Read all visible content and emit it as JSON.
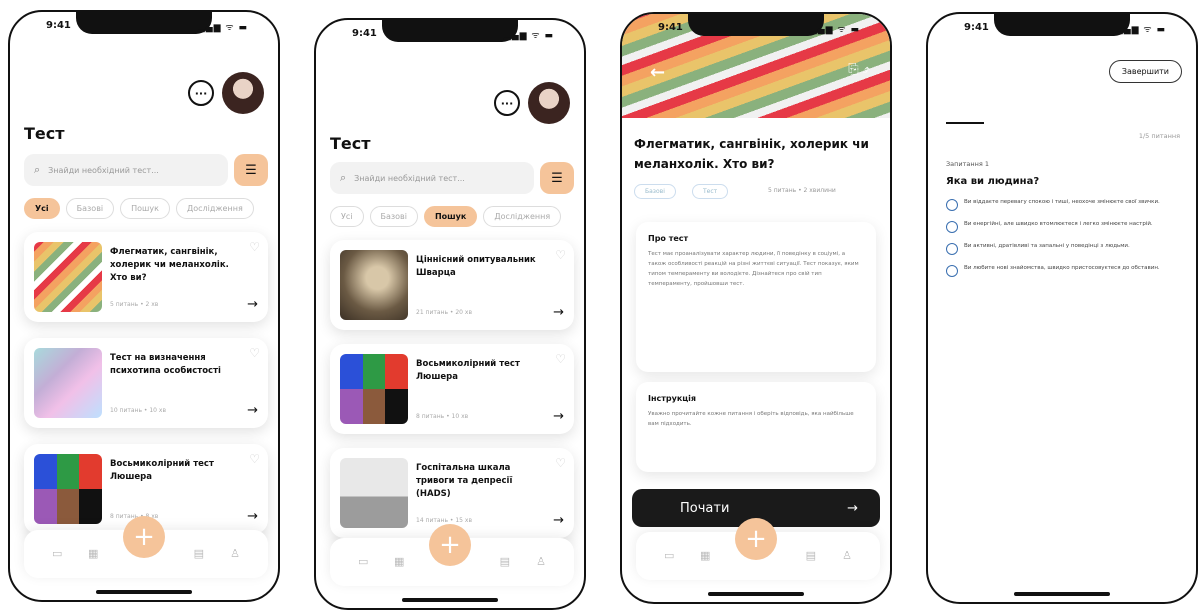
{
  "status": {
    "time": "9:41",
    "icons": "▂▄▆ ᯤ ▬"
  },
  "list_screen": {
    "title": "Тест",
    "search_placeholder": "Знайди необхідний тест...",
    "filter_icon": "sliders-icon",
    "chips": [
      "Усі",
      "Базові",
      "Пошук",
      "Дослідження"
    ],
    "chips_p2": [
      "Усі",
      "Базові",
      "Пошук",
      "Дослідження"
    ]
  },
  "screen1_cards": [
    {
      "title": "Флегматик, сангвінік, холерик чи меланхолік. Хто ви?",
      "meta": "5 питань  •  2 хв"
    },
    {
      "title": "Тест на визначення психотипа особистості",
      "meta": "10 питань  •  10 хв"
    },
    {
      "title": "Восьмиколірний тест Люшера",
      "meta": "8 питань  •  8 хв"
    }
  ],
  "screen2_cards": [
    {
      "title": "Ціннісний опитувальник Шварца",
      "meta": "21 питань  •  20 хв"
    },
    {
      "title": "Восьмиколірний тест Люшера",
      "meta": "8 питань  •  10 хв"
    },
    {
      "title": "Госпітальна шкала тривоги та депресії (HADS)",
      "meta": "14 питань  •  15 хв"
    }
  ],
  "detail": {
    "title": "Флегматик, сангвінік, холерик чи меланхолік. Хто ви?",
    "tags": [
      "Базові",
      "Тест"
    ],
    "meta": "5 питань  •  2 хвилини",
    "about_title": "Про тест",
    "about_text": "Тест має проаналізувати характер людини, її поведінку в соціумі, а також особливості реакцій на різні життєві ситуації. Тест показує, яким типом темпераменту ви володієте. Дізнайтеся про свій тип темпераменту, пройшовши тест.",
    "instr_title": "Інструкція",
    "instr_text": "Уважно прочитайте кожне питання і оберіть відповідь, яка найбільше вам підходить.",
    "start_label": "Почати",
    "start_arrow": "→"
  },
  "question": {
    "finish_label": "Завершити",
    "count": "1/5 питання",
    "number": "Запитання 1",
    "text": "Яка ви людина?",
    "options": [
      "Ви віддаєте перевагу спокою і тиші, неохоче змінюєте свої звички.",
      "Ви енергійні, але швидко втомлюєтеся і легко змінюєте настрій.",
      "Ви активні, дратівливі та запальні у поведінці з людьми.",
      "Ви любите нові знайомства, швидко пристосовуєтеся до обставин."
    ]
  },
  "icons": {
    "chat": "💬",
    "search": "⌕",
    "heart": "♡",
    "arrow": "→",
    "back": "←",
    "plus": "+",
    "nav": [
      "▭",
      "▦",
      "▤",
      "♙"
    ],
    "hero_actions": "⎘ ⤴"
  }
}
